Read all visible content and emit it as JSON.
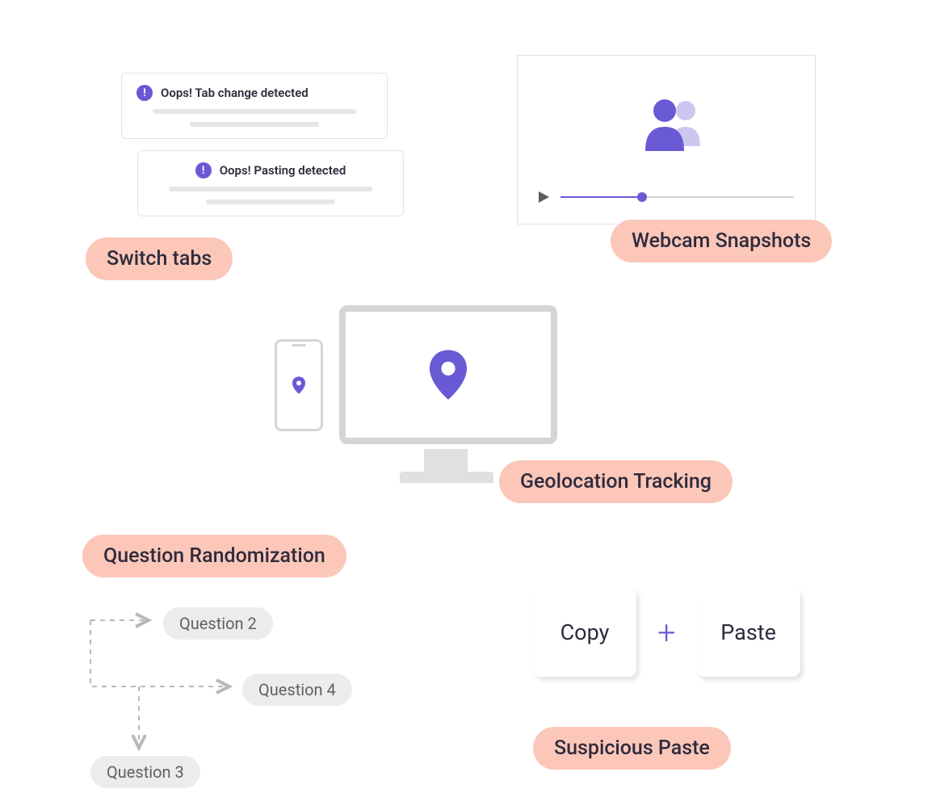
{
  "colors": {
    "accent": "#6a59d4",
    "pill": "#fcc7b9",
    "muted": "#d5d5d5",
    "chip": "#ececec",
    "text": "#2f2b3d"
  },
  "sections": {
    "switch_tabs": {
      "label": "Switch tabs",
      "alerts": [
        {
          "icon": "alert-icon",
          "text": "Oops! Tab change detected"
        },
        {
          "icon": "alert-icon",
          "text": "Oops! Pasting detected"
        }
      ]
    },
    "webcam": {
      "label": "Webcam Snapshots",
      "slider_progress_pct": 35
    },
    "geolocation": {
      "label": "Geolocation Tracking"
    },
    "question_randomization": {
      "label": "Question Randomization",
      "chips": [
        {
          "label": "Question 2"
        },
        {
          "label": "Question 4"
        },
        {
          "label": "Question 3"
        }
      ]
    },
    "suspicious_paste": {
      "label": "Suspicious Paste",
      "tiles": {
        "copy": "Copy",
        "plus": "+",
        "paste": "Paste"
      }
    }
  }
}
